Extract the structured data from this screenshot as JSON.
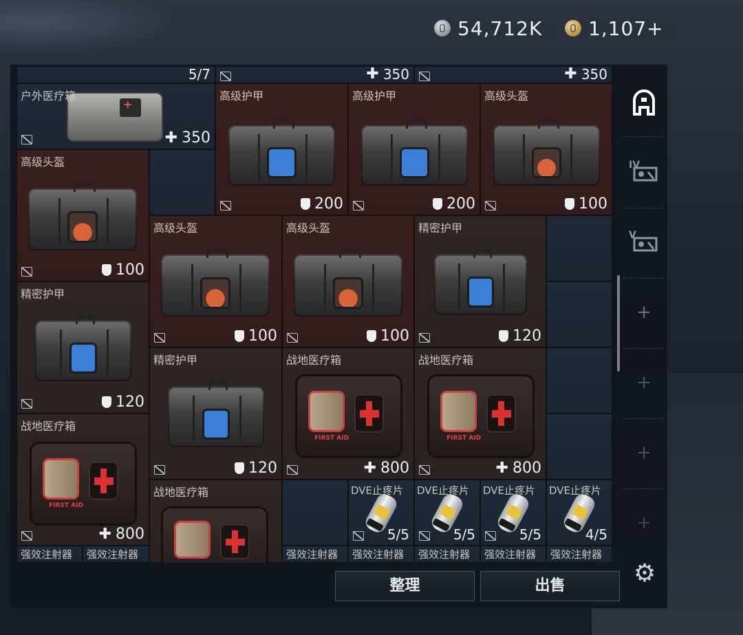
{
  "currency": [
    {
      "icon": "silver-coin-icon",
      "value": "54,712K"
    },
    {
      "icon": "gold-coin-icon",
      "value": "1,107+"
    }
  ],
  "top_row": [
    {
      "value": "5/7"
    },
    {
      "value": "350",
      "icon": "plus-icon"
    },
    {
      "value": "350",
      "icon": "plus-icon"
    }
  ],
  "items": [
    {
      "id": "i01",
      "label": "户外医疗箱",
      "value": "350",
      "icon": "plus-icon",
      "art": "outdoor-kit"
    },
    {
      "id": "i02",
      "label": "高级护甲",
      "value": "200",
      "icon": "shield-icon",
      "art": "armor-blue"
    },
    {
      "id": "i03",
      "label": "高级护甲",
      "value": "200",
      "icon": "shield-icon",
      "art": "armor-blue"
    },
    {
      "id": "i04",
      "label": "高级头盔",
      "value": "100",
      "icon": "shield-icon",
      "art": "helmet-bag"
    },
    {
      "id": "i05",
      "label": "高级头盔",
      "value": "100",
      "icon": "shield-icon",
      "art": "helmet-bag"
    },
    {
      "id": "i06",
      "label": "高级头盔",
      "value": "100",
      "icon": "shield-icon",
      "art": "helmet-bag"
    },
    {
      "id": "i07",
      "label": "高级头盔",
      "value": "100",
      "icon": "shield-icon",
      "art": "helmet-bag"
    },
    {
      "id": "i08",
      "label": "精密护甲",
      "value": "120",
      "icon": "shield-icon",
      "art": "armor-dark"
    },
    {
      "id": "i09",
      "label": "精密护甲",
      "value": "120",
      "icon": "shield-icon",
      "art": "armor-dark"
    },
    {
      "id": "i10",
      "label": "精密护甲",
      "value": "120",
      "icon": "shield-icon",
      "art": "armor-dark"
    },
    {
      "id": "i11",
      "label": "战地医疗箱",
      "value": "800",
      "icon": "plus-icon",
      "art": "first-aid"
    },
    {
      "id": "i12",
      "label": "战地医疗箱",
      "value": "800",
      "icon": "plus-icon",
      "art": "first-aid"
    },
    {
      "id": "i13",
      "label": "战地医疗箱",
      "value": "800",
      "icon": "plus-icon",
      "art": "first-aid"
    },
    {
      "id": "i14",
      "label": "战地医疗箱",
      "value": "",
      "icon": "",
      "art": "first-aid"
    },
    {
      "id": "i15",
      "label": "DVE止疼片",
      "value": "5/5",
      "art": "pill"
    },
    {
      "id": "i16",
      "label": "DVE止疼片",
      "value": "5/5",
      "art": "pill"
    },
    {
      "id": "i17",
      "label": "DVE止疼片",
      "value": "5/5",
      "art": "pill"
    },
    {
      "id": "i18",
      "label": "DVE止疼片",
      "value": "4/5",
      "art": "pill"
    }
  ],
  "bottom_labels": [
    "强效注射器",
    "强效注射器",
    "强效注射器",
    "强效注射器",
    "强效注射器",
    "强效注射器",
    "强效注射器"
  ],
  "sidebar": [
    {
      "name": "backpack-tab",
      "icon": "backpack-icon",
      "label": ""
    },
    {
      "name": "case-iv-tab",
      "icon": "case-icon",
      "label": "IV"
    },
    {
      "name": "case-v-tab",
      "icon": "case-icon",
      "label": "V"
    },
    {
      "name": "add-slot-1",
      "icon": "plus-icon",
      "label": "+"
    },
    {
      "name": "add-slot-2",
      "icon": "plus-icon",
      "label": "+"
    },
    {
      "name": "add-slot-3",
      "icon": "plus-icon",
      "label": "+"
    },
    {
      "name": "add-slot-4",
      "icon": "plus-icon",
      "label": "+"
    }
  ],
  "buttons": {
    "sort": "整理",
    "sell": "出售"
  }
}
